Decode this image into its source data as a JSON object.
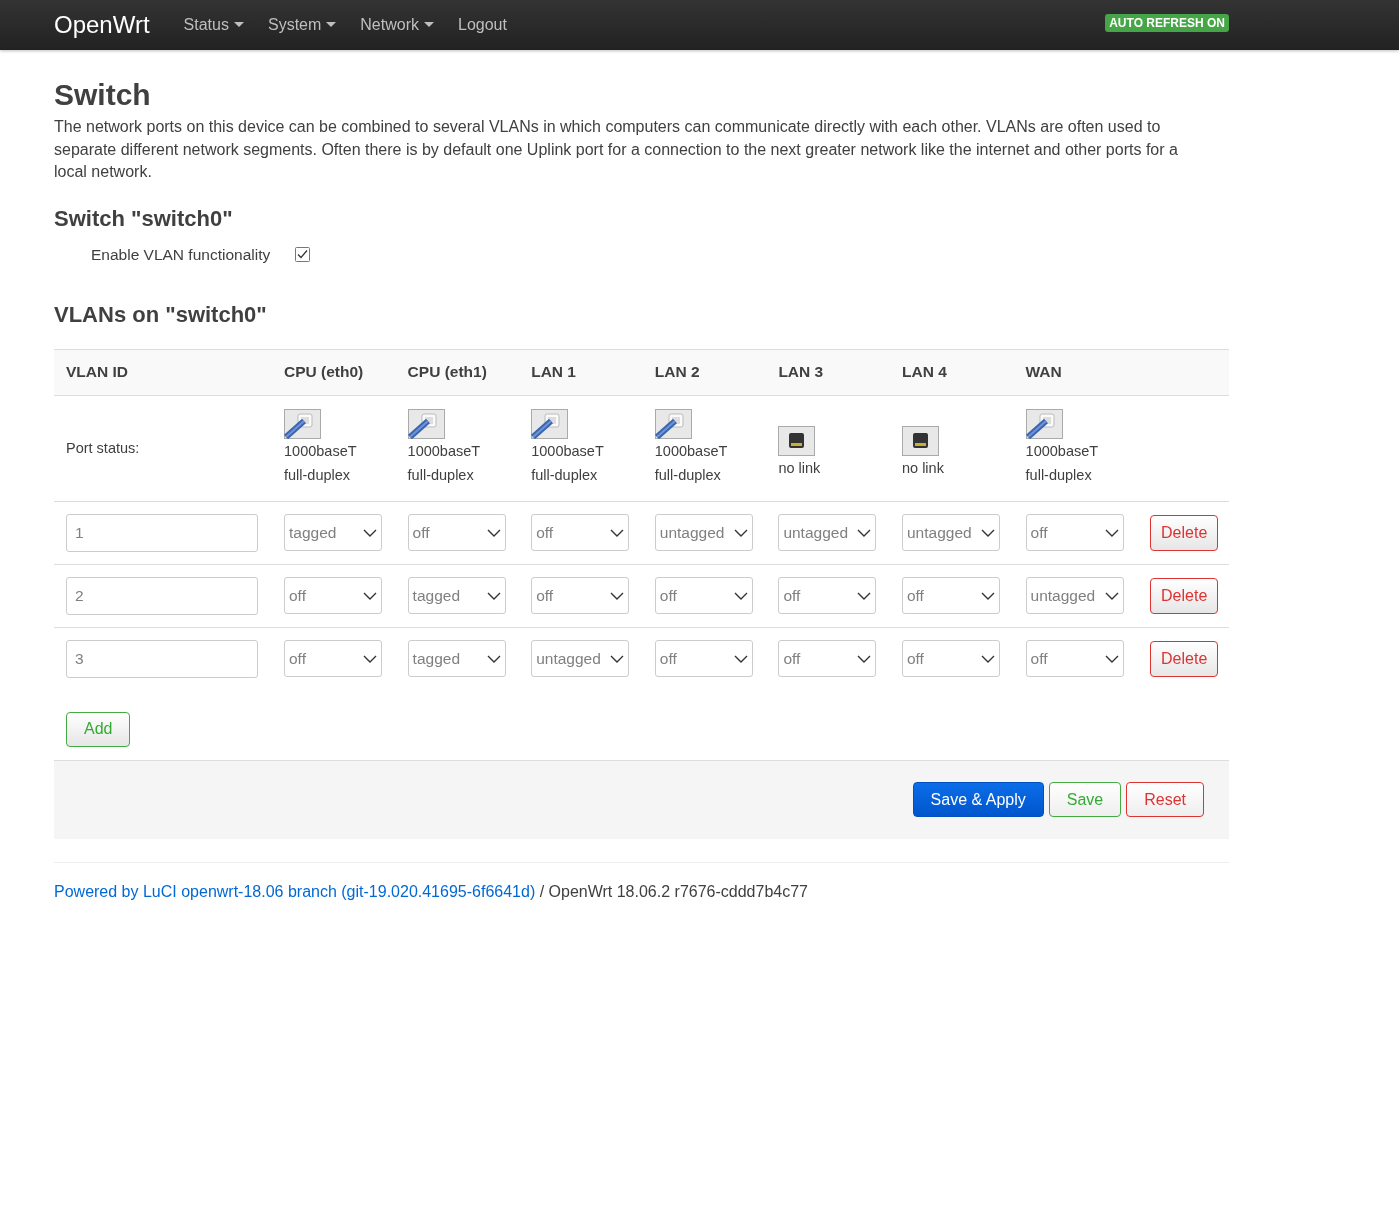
{
  "navbar": {
    "brand": "OpenWrt",
    "menu": [
      {
        "label": "Status",
        "dropdown": true
      },
      {
        "label": "System",
        "dropdown": true
      },
      {
        "label": "Network",
        "dropdown": true
      },
      {
        "label": "Logout",
        "dropdown": false
      }
    ],
    "badge": "AUTO REFRESH ON"
  },
  "title": "Switch",
  "description": "The network ports on this device can be combined to several VLANs in which computers can communicate directly with each other. VLANs are often used to separate different network segments. Often there is by default one Uplink port for a connection to the next greater network like the internet and other ports for a local network.",
  "switch_section": {
    "title": "Switch \"switch0\"",
    "option": {
      "label": "Enable VLAN functionality",
      "checked": true
    }
  },
  "vlans_section": {
    "title": "VLANs on \"switch0\"",
    "table": {
      "id_column": "VLAN ID",
      "status_label": "Port status:",
      "ports": [
        {
          "label": "CPU (eth0)",
          "link": true,
          "lines": [
            "1000baseT",
            "full-duplex"
          ]
        },
        {
          "label": "CPU (eth1)",
          "link": true,
          "lines": [
            "1000baseT",
            "full-duplex"
          ]
        },
        {
          "label": "LAN 1",
          "link": true,
          "lines": [
            "1000baseT",
            "full-duplex"
          ]
        },
        {
          "label": "LAN 2",
          "link": true,
          "lines": [
            "1000baseT",
            "full-duplex"
          ]
        },
        {
          "label": "LAN 3",
          "link": false,
          "lines": [
            "no link"
          ]
        },
        {
          "label": "LAN 4",
          "link": false,
          "lines": [
            "no link"
          ]
        },
        {
          "label": "WAN",
          "link": true,
          "lines": [
            "1000baseT",
            "full-duplex"
          ]
        }
      ],
      "rows": [
        {
          "id": "1",
          "values": [
            "tagged",
            "off",
            "off",
            "untagged",
            "untagged",
            "untagged",
            "off"
          ],
          "delete": "Delete"
        },
        {
          "id": "2",
          "values": [
            "off",
            "tagged",
            "off",
            "off",
            "off",
            "off",
            "untagged"
          ],
          "delete": "Delete"
        },
        {
          "id": "3",
          "values": [
            "off",
            "tagged",
            "untagged",
            "off",
            "off",
            "off",
            "off"
          ],
          "delete": "Delete"
        }
      ]
    },
    "add_button": "Add"
  },
  "actions": [
    {
      "kind": "primary",
      "label": "Save & Apply"
    },
    {
      "kind": "positive",
      "label": "Save"
    },
    {
      "kind": "negative",
      "label": "Reset"
    }
  ],
  "footer": {
    "link": "Powered by LuCI openwrt-18.06 branch (git-19.020.41695-6f6641d)",
    "text": "/ OpenWrt 18.06.2 r7676-cddd7b4c77"
  }
}
